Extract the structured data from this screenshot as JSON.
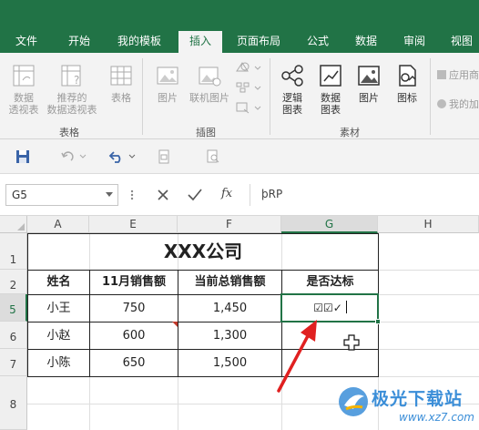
{
  "tabs": [
    {
      "label": "文件",
      "active": false
    },
    {
      "label": "开始",
      "active": false
    },
    {
      "label": "我的模板",
      "active": false
    },
    {
      "label": "插入",
      "active": true
    },
    {
      "label": "页面布局",
      "active": false
    },
    {
      "label": "公式",
      "active": false
    },
    {
      "label": "数据",
      "active": false
    },
    {
      "label": "审阅",
      "active": false
    },
    {
      "label": "视图",
      "active": false
    }
  ],
  "ribbon": {
    "tables_group": {
      "label": "表格",
      "buttons": [
        {
          "line1": "数据",
          "line2": "透视表",
          "enabled": false
        },
        {
          "line1": "推荐的",
          "line2": "数据透视表",
          "enabled": false
        },
        {
          "line1": "表格",
          "line2": "",
          "enabled": false
        }
      ]
    },
    "illustrations_group": {
      "label": "插图",
      "buttons": [
        {
          "line1": "图片",
          "enabled": false
        },
        {
          "line1": "联机图片",
          "enabled": false
        }
      ]
    },
    "material_group": {
      "label": "素材",
      "buttons": [
        {
          "line1": "逻辑",
          "line2": "图表",
          "enabled": true
        },
        {
          "line1": "数据",
          "line2": "图表",
          "enabled": true
        },
        {
          "line1": "图片",
          "line2": "",
          "enabled": true
        },
        {
          "line1": "图标",
          "line2": "",
          "enabled": true
        }
      ]
    },
    "right_items": [
      {
        "label": "应用商"
      },
      {
        "label": "我的加"
      }
    ]
  },
  "formula_bar": {
    "name_box": "G5",
    "formula": "þRP",
    "fx_label": "fx"
  },
  "sheet": {
    "columns": [
      "A",
      "E",
      "F",
      "G",
      "H"
    ],
    "rows": [
      "1",
      "2",
      "5",
      "6",
      "7",
      "8"
    ],
    "title": "XXX公司",
    "headers": [
      "姓名",
      "11月销售额",
      "当前总销售额",
      "是否达标"
    ],
    "data": [
      [
        "小王",
        "750",
        "1,450",
        "☑☑✓"
      ],
      [
        "小赵",
        "600",
        "1,300",
        ""
      ],
      [
        "小陈",
        "650",
        "1,500",
        ""
      ]
    ]
  },
  "colors": {
    "accent": "#217346",
    "arrow": "#e02020"
  }
}
